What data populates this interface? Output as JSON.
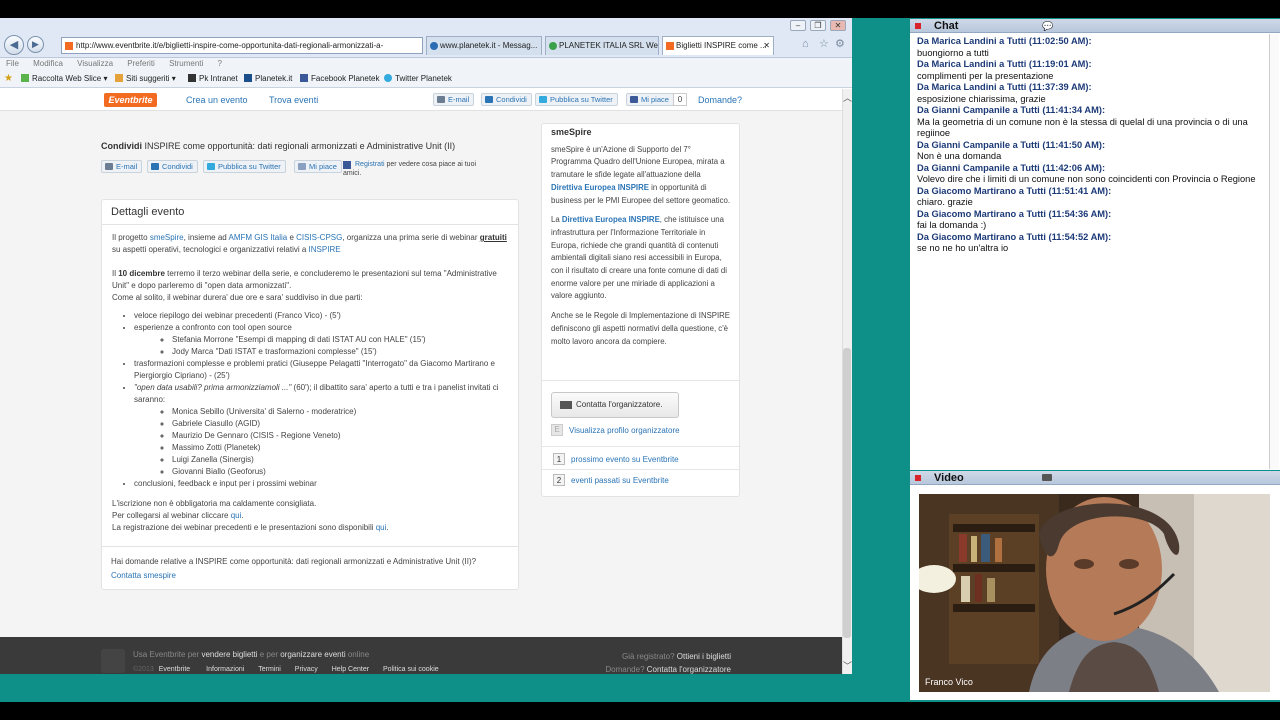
{
  "browser": {
    "url": "http://www.eventbrite.it/e/biglietti-inspire-come-opportunita-dati-regionali-armonizzati-a-",
    "tabs": [
      {
        "label": "www.planetek.it - Messag..."
      },
      {
        "label": "PLANETEK ITALIA SRL We..."
      },
      {
        "label": "Biglietti INSPIRE come ..."
      }
    ],
    "menu": [
      "File",
      "Modifica",
      "Visualizza",
      "Preferiti",
      "Strumenti",
      "?"
    ],
    "favorites": [
      "Raccolta Web Slice",
      "Siti suggeriti",
      "Pk Intranet",
      "Planetek.it",
      "Facebook Planetek",
      "Twitter Planetek"
    ]
  },
  "eventbrite": {
    "logo": "Eventbrite",
    "nav": [
      "Crea un evento",
      "Trova eventi"
    ],
    "share_top": [
      "E-mail",
      "Condividi",
      "Pubblica su Twitter",
      "Mi piace"
    ],
    "like_count": "0",
    "domande": "Domande?"
  },
  "share_section": {
    "title_bold": "Condividi",
    "title_rest": " INSPIRE come opportunità: dati regionali armonizzati e Administrative Unit (II)",
    "buttons": [
      "E-mail",
      "Condividi",
      "Pubblica su Twitter",
      "Mi piace"
    ],
    "register_link": "Registrati",
    "register_text": " per vedere cosa piace ai tuoi amici."
  },
  "details": {
    "heading": "Dettagli evento",
    "intro": {
      "p1": "Il progetto ",
      "smespire": "smeSpire",
      "p2": ", insieme ad ",
      "amfm": "AMFM GIS Italia",
      "p3": " e ",
      "cisis": "CISIS-CPSG",
      "p4": ", organizza una prima serie di webinar ",
      "gratuiti": "gratuiti",
      "p5": " su  aspetti operativi, tecnologici e organizzativi relativi a ",
      "inspire": "INSPIRE"
    },
    "para2_a": "Il ",
    "para2_date": "10 dicembre",
    "para2_b": " terremo il terzo webinar della serie, e concluderemo le presentazioni sul tema  \"Administrative Unit\" e dopo parleremo di \"open data armonizzati\".",
    "para2_c": "Come al solito, il webinar durera' due ore e sara' suddiviso in due parti:",
    "items": {
      "i1": "veloce riepilogo dei webinar precedenti (Franco Vico) - (5')",
      "i2": "esperienze a confronto con tool open source",
      "i2a": "Stefania Morrone \"Esempi di mapping di dati ISTAT AU con HALE\" (15')",
      "i2b": "Jody Marca \"Dati ISTAT e trasformazioni complesse\" (15')",
      "i3": "trasformazioni complesse e problemi pratici (Giuseppe Pelagatti \"Interrogato\" da Giacomo Martirano e Piergiorgio Cipriano) - (25')",
      "i4_em": "\"open data usabili? prima armonizziamoli ...\"",
      "i4_rest": " (60'); il dibattito sara' aperto a tutti e tra i panelist invitati ci saranno:",
      "i4a": "Monica Sebillo (Universita' di Salerno - moderatrice)",
      "i4b": "Gabriele Ciasullo (AGID)",
      "i4c": "Maurizio De Gennaro (CISIS - Regione Veneto)",
      "i4d": "Massimo Zotti (Planetek)",
      "i4e": "Luigi Zanella (Sinergis)",
      "i4f": "Giovanni Biallo (Geoforus)",
      "i5": "conclusioni, feedback e input per i prossimi webinar"
    },
    "closing1": "L'iscrizione non è obbligatoria ma caldamente consigliata.",
    "closing2_a": "Per collegarsi al webinar cliccare ",
    "qui": "qui",
    "closing2_b": ".",
    "closing3_a": "La registrazione dei webinar precedenti e le presentazioni sono disponibili ",
    "closing3_b": ".",
    "footer_q": "Hai domande relative a INSPIRE come opportunità: dati regionali armonizzati e Administrative Unit (II)?",
    "footer_link": "Contatta smespire"
  },
  "sidebar": {
    "org_title": "smeSpire",
    "org_p1": "smeSpire è un'Azione di Supporto del 7° Programma Quadro dell'Unione Europea, mirata a tramutare le sfide legate all'attuazione della ",
    "org_p1_link": "Direttiva Europea INSPIRE",
    "org_p1_end": " in opportunità di business per le PMI Europee del settore geomatico.",
    "org_p2_a": "La ",
    "org_p2_link": "Direttiva Europea INSPIRE",
    "org_p2_b": ", che istituisce una infrastruttura per l'Informazione Territoriale in Europa, richiede che grandi quantità di contenuti ambientali digitali siano resi accessibili in Europa, con il risultato di creare una fonte comune di dati di enorme valore per une miriade di applicazioni a valore aggiunto.",
    "org_p3": "Anche se le Regole di Implementazione di INSPIRE definiscono gli aspetti normativi della questione, c'è molto lavoro ancora da compiere.",
    "contact_btn": "Contatta l'organizzatore.",
    "profile_link": "Visualizza profilo organizzatore",
    "next_n": "1",
    "next_label": "prossimo evento su Eventbrite",
    "past_n": "2",
    "past_label": "eventi passati su Eventbrite"
  },
  "page_footer": {
    "l1_a": "Usa Eventbrite per ",
    "l1_b": "vendere biglietti",
    "l1_c": " e per ",
    "l1_d": "organizzare eventi",
    "l1_e": " online",
    "copy": "©2013",
    "links": [
      "Eventbrite",
      "Informazioni",
      "Termini",
      "Privacy",
      "Help Center",
      "Politica sui cookie"
    ],
    "r1_a": "Già registrato? ",
    "r1_b": "Ottieni i biglietti",
    "r2_a": "Domande? ",
    "r2_b": "Contatta l'organizzatore"
  },
  "chat": {
    "title": "Chat",
    "messages": [
      {
        "from": "Da Marica Landini a Tutti (11:02:50 AM):",
        "text": "buongiorno a tutti"
      },
      {
        "from": "Da Marica Landini a Tutti (11:19:01 AM):",
        "text": "complimenti per la presentazione"
      },
      {
        "from": "Da Marica Landini a Tutti (11:37:39 AM):",
        "text": "esposizione chiarissima, grazie"
      },
      {
        "from": "Da Gianni Campanile a Tutti (11:41:34 AM):",
        "text": "Ma la geometria di un comune non è la stessa di quelal di una provincia o di una regiinoe"
      },
      {
        "from": "Da Gianni Campanile a Tutti (11:41:50 AM):",
        "text": "Non è una domanda"
      },
      {
        "from": "Da Gianni Campanile a Tutti (11:42:06 AM):",
        "text": "Volevo dire che i limiti di un comune non sono coincidenti con Provincia o Regione"
      },
      {
        "from": "Da Giacomo Martirano a Tutti (11:51:41 AM):",
        "text": "chiaro. grazie"
      },
      {
        "from": "Da Giacomo Martirano a Tutti (11:54:36 AM):",
        "text": "fai la domanda :)"
      },
      {
        "from": "Da Giacomo Martirano a Tutti (11:54:52 AM):",
        "text": "se no ne ho un'altra io"
      }
    ]
  },
  "video": {
    "title": "Video",
    "speaker": "Franco Vico"
  }
}
